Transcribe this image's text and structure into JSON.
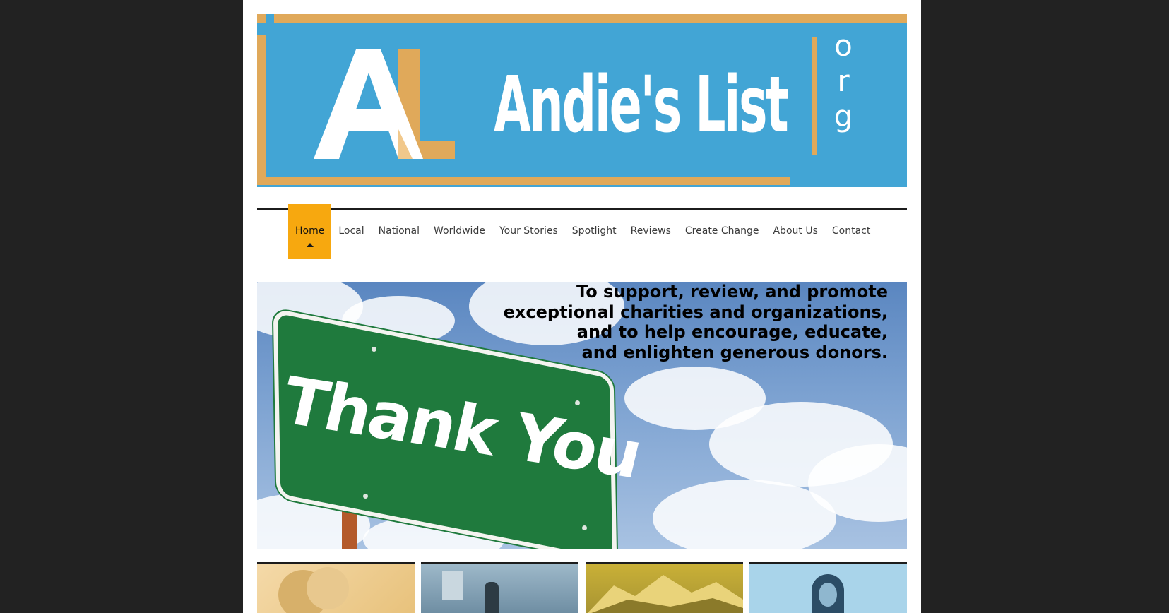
{
  "site": {
    "logo_initials": "AL",
    "logo_name": "Andie's List",
    "logo_tld_letters": [
      "o",
      "r",
      "g"
    ]
  },
  "nav": {
    "items": [
      {
        "label": "Home",
        "active": true
      },
      {
        "label": "Local"
      },
      {
        "label": "National"
      },
      {
        "label": "Worldwide"
      },
      {
        "label": "Your Stories"
      },
      {
        "label": "Spotlight"
      },
      {
        "label": "Reviews"
      },
      {
        "label": "Create Change"
      },
      {
        "label": "About Us"
      },
      {
        "label": "Contact"
      }
    ]
  },
  "hero": {
    "sign_text": "Thank You",
    "mission_lines": [
      "To support, review, and promote",
      "exceptional charities and organizations,",
      "and to help encourage, educate,",
      "and enlighten generous donors."
    ]
  },
  "colors": {
    "banner_blue": "#42a5d5",
    "banner_gold": "#e0a95a",
    "nav_active": "#f7a80f",
    "page_bg": "#222222",
    "sign_green": "#1f7a3d"
  }
}
